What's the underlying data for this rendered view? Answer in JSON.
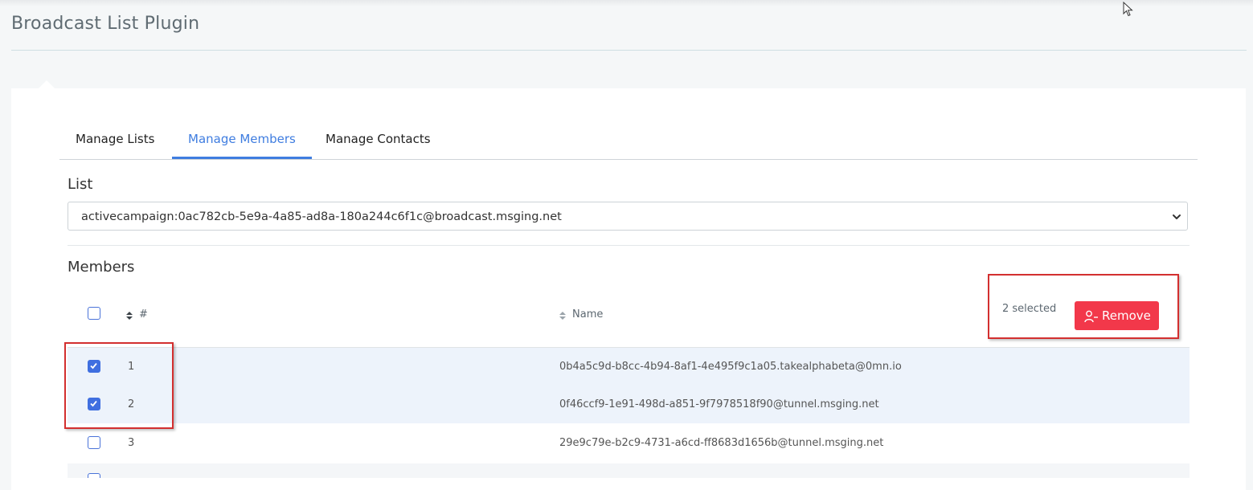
{
  "page": {
    "title": "Broadcast List Plugin"
  },
  "tabs": [
    {
      "label": "Manage Lists",
      "active": false
    },
    {
      "label": "Manage Members",
      "active": true
    },
    {
      "label": "Manage Contacts",
      "active": false
    }
  ],
  "list_section": {
    "label": "List",
    "selected_value": "activecampaign:0ac782cb-5e9a-4a85-ad8a-180a244c6f1c@broadcast.msging.net"
  },
  "members_section": {
    "label": "Members",
    "columns": {
      "number": "#",
      "name": "Name"
    },
    "selected_count_text": "2 selected",
    "remove_label": "Remove",
    "rows": [
      {
        "number": "1",
        "name": "0b4a5c9d-b8cc-4b94-8af1-4e495f9c1a05.takealphabeta@0mn.io",
        "checked": true
      },
      {
        "number": "2",
        "name": "0f46ccf9-1e91-498d-a851-9f7978518f90@tunnel.msging.net",
        "checked": true
      },
      {
        "number": "3",
        "name": "29e9c79e-b2c9-4731-a6cd-ff8683d1656b@tunnel.msging.net",
        "checked": false
      }
    ]
  },
  "colors": {
    "accent": "#3f7de0",
    "danger": "#f2384a",
    "highlight": "#d32f2f"
  },
  "icons": [
    "cursor-icon",
    "chevron-down-icon",
    "sort-icon",
    "user-remove-icon",
    "checkmark-icon"
  ]
}
